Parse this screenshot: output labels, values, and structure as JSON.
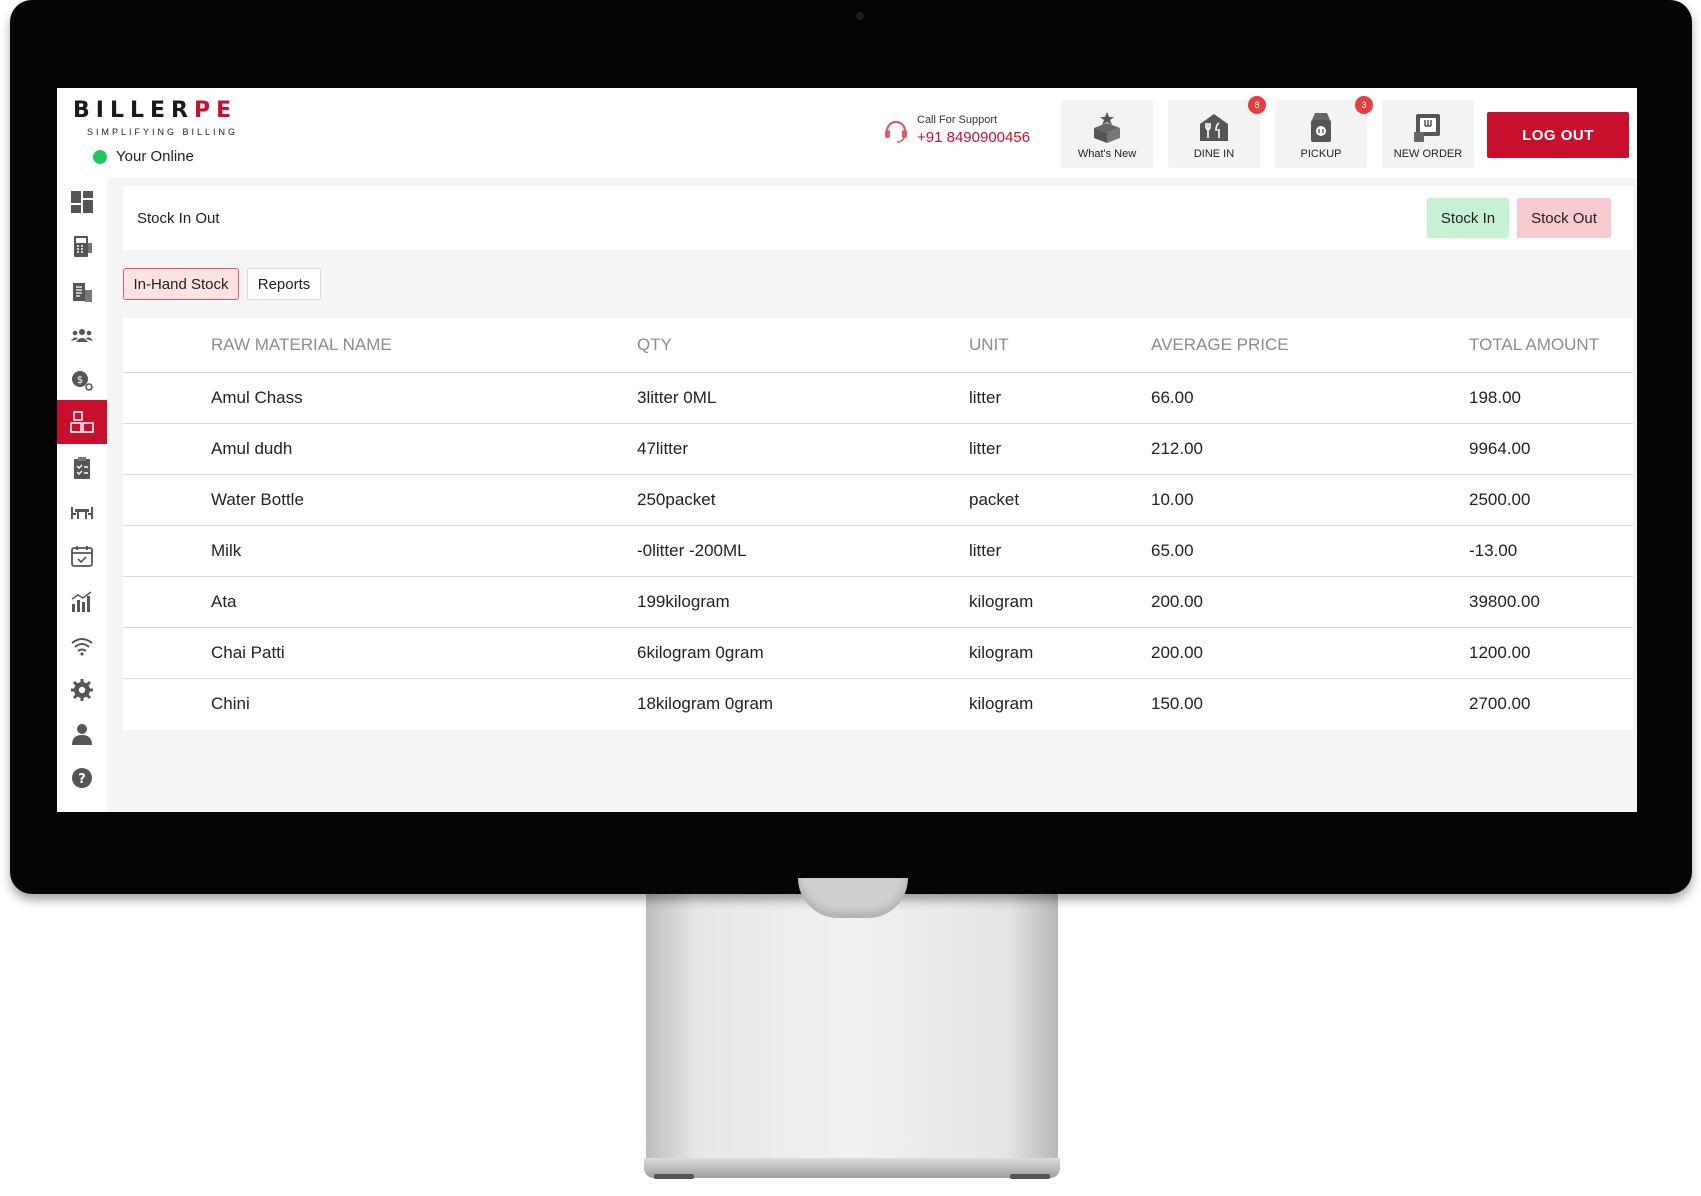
{
  "brand": {
    "name_main": "BILLER",
    "name_accent": "PE",
    "tagline": "SIMPLIFYING BILLING"
  },
  "status": {
    "online_label": "Your Online",
    "online_color": "#22c55e"
  },
  "support": {
    "label": "Call For Support",
    "phone": "+91 8490900456"
  },
  "header_buttons": {
    "whats_new": {
      "label": "What's New"
    },
    "dine_in": {
      "label": "DINE IN",
      "badge": "8"
    },
    "pickup": {
      "label": "PICKUP",
      "badge": "3"
    },
    "new_order": {
      "label": "NEW ORDER"
    }
  },
  "logout_label": "LOG OUT",
  "sidebar": {
    "items": [
      {
        "icon": "dashboard-icon"
      },
      {
        "icon": "pos-terminal-icon"
      },
      {
        "icon": "billing-icon"
      },
      {
        "icon": "customers-icon"
      },
      {
        "icon": "expense-icon"
      },
      {
        "icon": "inventory-icon",
        "active": true
      },
      {
        "icon": "clipboard-icon"
      },
      {
        "icon": "table-icon"
      },
      {
        "icon": "calendar-icon"
      },
      {
        "icon": "reports-icon"
      },
      {
        "icon": "wifi-icon"
      },
      {
        "icon": "settings-icon"
      },
      {
        "icon": "user-icon"
      },
      {
        "icon": "help-icon"
      }
    ]
  },
  "page": {
    "title": "Stock In Out",
    "stock_in_label": "Stock In",
    "stock_out_label": "Stock Out"
  },
  "tabs": {
    "in_hand": "In-Hand Stock",
    "reports": "Reports"
  },
  "table": {
    "headers": [
      "RAW MATERIAL NAME",
      "QTY",
      "UNIT",
      "AVERAGE PRICE",
      "TOTAL AMOUNT"
    ],
    "rows": [
      [
        "Amul Chass",
        "3litter 0ML",
        "litter",
        "66.00",
        "198.00"
      ],
      [
        "Amul dudh",
        "47litter",
        "litter",
        "212.00",
        "9964.00"
      ],
      [
        "Water Bottle",
        "250packet",
        "packet",
        "10.00",
        "2500.00"
      ],
      [
        "Milk",
        "-0litter -200ML",
        "litter",
        "65.00",
        "-13.00"
      ],
      [
        "Ata",
        "199kilogram",
        "kilogram",
        "200.00",
        "39800.00"
      ],
      [
        "Chai Patti",
        "6kilogram 0gram",
        "kilogram",
        "200.00",
        "1200.00"
      ],
      [
        "Chini",
        "18kilogram 0gram",
        "kilogram",
        "150.00",
        "2700.00"
      ]
    ]
  },
  "colors": {
    "brand_red": "#c8102e",
    "stock_in_bg": "#c6f1d3",
    "stock_out_bg": "#f7cbcf"
  }
}
